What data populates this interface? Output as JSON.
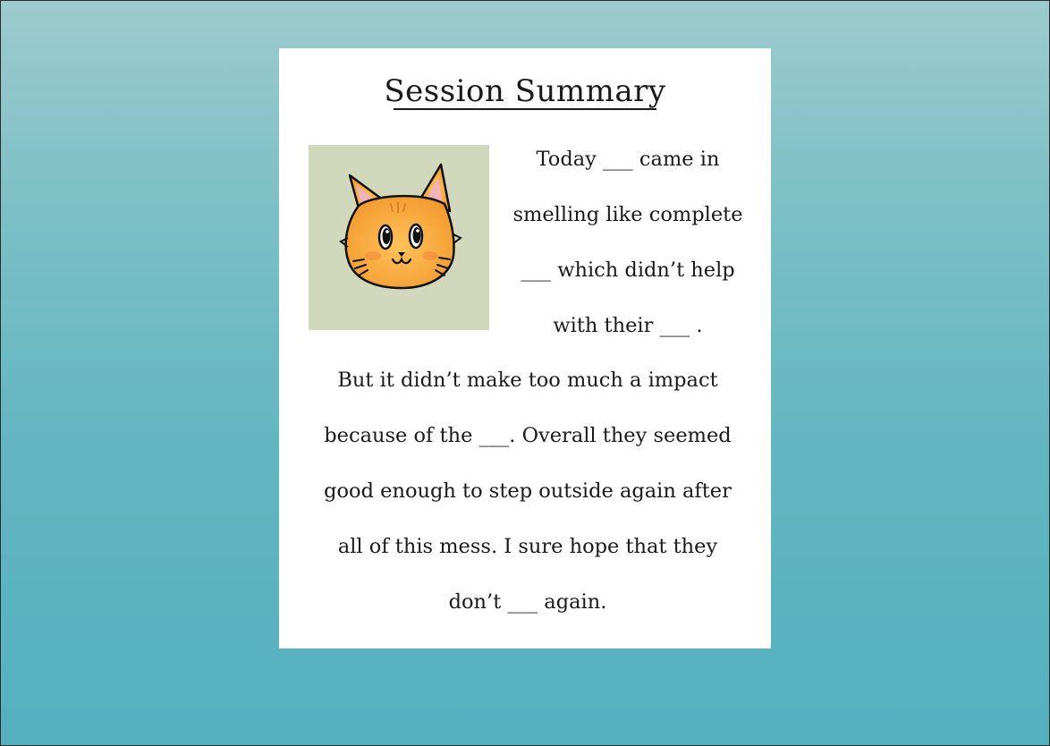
{
  "summary": {
    "title": "Session Summary",
    "intro_lines": [
      "Today ___ came in",
      "smelling like complete",
      "___ which didn’t help",
      "with their ___ ."
    ],
    "body_lines": [
      "But it didn’t make too much a impact",
      "because of the ___. Overall they seemed",
      "good enough to step outside again after",
      "all of this mess. I sure hope that they",
      "don’t ___ again."
    ]
  },
  "portrait": {
    "icon": "cat-face-icon",
    "background": "#d1d8bc",
    "fur_color": "#f5a83a"
  },
  "colors": {
    "background_top": "#9ccbcf",
    "background_bottom": "#55b0bf",
    "card": "#ffffff",
    "text": "#1a1a1a"
  }
}
